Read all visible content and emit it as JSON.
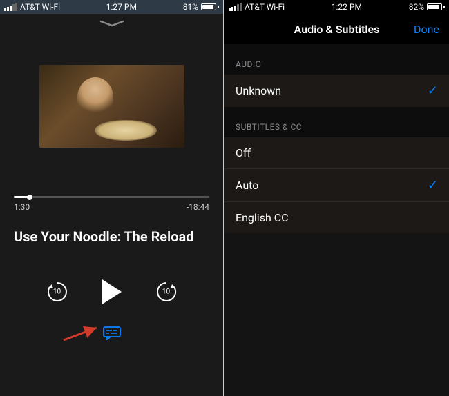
{
  "left": {
    "status": {
      "carrier": "AT&T Wi-Fi",
      "time": "1:27 PM",
      "battery_pct": "81%",
      "battery_fill_pct": 81
    },
    "player": {
      "elapsed": "1:30",
      "remaining": "-18:44",
      "progress_pct": 8,
      "title": "Use Your Noodle: The Reload",
      "skip_back_seconds": "10",
      "skip_fwd_seconds": "10"
    }
  },
  "right": {
    "status": {
      "carrier": "AT&T Wi-Fi",
      "time": "1:22 PM",
      "battery_pct": "82%",
      "battery_fill_pct": 82
    },
    "nav": {
      "title": "Audio & Subtitles",
      "done_label": "Done"
    },
    "sections": {
      "audio": {
        "header": "AUDIO",
        "items": [
          {
            "label": "Unknown",
            "checked": true
          }
        ]
      },
      "subtitles": {
        "header": "SUBTITLES & CC",
        "items": [
          {
            "label": "Off",
            "checked": false
          },
          {
            "label": "Auto",
            "checked": true
          },
          {
            "label": "English CC",
            "checked": false
          }
        ]
      }
    }
  }
}
